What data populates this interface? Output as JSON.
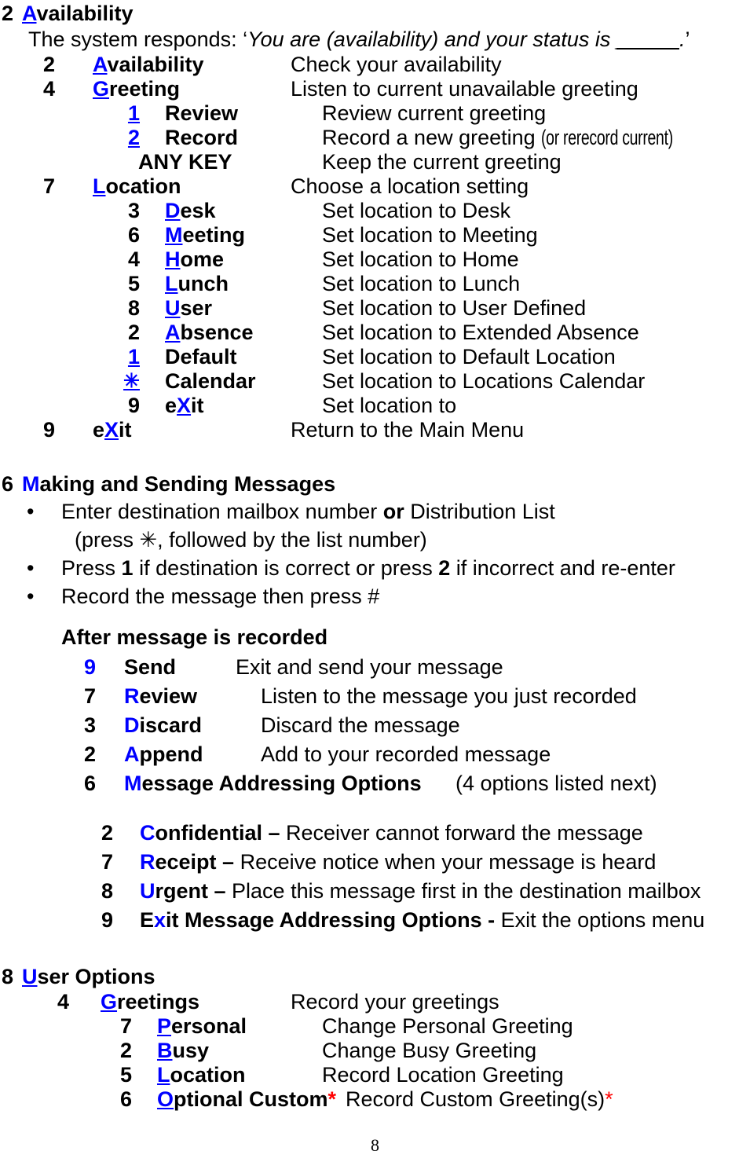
{
  "page": {
    "number": "8"
  },
  "sections": [
    {
      "id": "availability",
      "key": "2",
      "accent_letter": "A",
      "title_rest": "vailability",
      "prompt_prefix": "The system responds: ",
      "prompt_open_quote": "‘",
      "prompt_italic": "You are (availability) and your status is ",
      "prompt_blank": "_____",
      "prompt_tail": ".",
      "prompt_close_quote": "’",
      "entries": [
        {
          "key": "2",
          "accent": "A",
          "rest": "vailability",
          "desc": "Check your availability"
        },
        {
          "key": "4",
          "accent": "G",
          "rest": "reeting",
          "desc": "Listen to current unavailable greeting"
        }
      ],
      "greeting_sub": [
        {
          "key": "1",
          "key_blue": true,
          "name": "Review",
          "desc": "Review current greeting"
        },
        {
          "key": "2",
          "key_blue": true,
          "name": "Record",
          "desc": "Record a new greeting ",
          "desc_condensed": "(or rerecord current)"
        },
        {
          "key": "ANY KEY",
          "key_blue": false,
          "name": "",
          "desc": "Keep the current greeting"
        }
      ],
      "location": {
        "key": "7",
        "accent": "L",
        "rest": "ocation",
        "desc": "Choose a location setting"
      },
      "location_sub": [
        {
          "key": "3",
          "key_blue": false,
          "accent": "D",
          "rest": "esk",
          "desc": "Set location to Desk"
        },
        {
          "key": "6",
          "key_blue": false,
          "accent": "M",
          "rest": "eeting",
          "desc": "Set location to Meeting"
        },
        {
          "key": "4",
          "key_blue": false,
          "accent": "H",
          "rest": "ome",
          "desc": "Set location to Home"
        },
        {
          "key": "5",
          "key_blue": false,
          "accent": "L",
          "rest": "unch",
          "desc": "Set location to Lunch"
        },
        {
          "key": "8",
          "key_blue": false,
          "accent": "U",
          "rest": "ser",
          "desc": "Set location to User Defined"
        },
        {
          "key": "2",
          "key_blue": false,
          "accent": "A",
          "rest": "bsence",
          "desc": "Set location to Extended Absence"
        },
        {
          "key": "1",
          "key_blue": true,
          "accent": "",
          "rest": "Default",
          "desc": "Set location to Default Location"
        },
        {
          "key": "✳",
          "key_blue": true,
          "accent": "",
          "rest": "Calendar",
          "desc": "Set location to Locations Calendar"
        },
        {
          "key": "9",
          "key_blue": false,
          "accent": "",
          "pre": "e",
          "accent_mid": "X",
          "rest": "it",
          "desc": "Set location to"
        }
      ],
      "exit": {
        "key": "9",
        "pre": "e",
        "accent": "X",
        "rest": "it",
        "desc": "Return to the Main Menu"
      }
    },
    {
      "id": "making-sending",
      "key": "6",
      "accent_letter": "M",
      "accent_underline": false,
      "title_rest": "aking and Sending Messages",
      "bullets": [
        {
          "pre": "Enter destination mailbox number ",
          "bold": "or",
          "post": " Distribution List",
          "continuation": "(press ✳, followed by the list number)"
        },
        {
          "pre": "Press ",
          "bold": "1",
          "post": " if destination is correct or press ",
          "bold2": "2",
          "post2": " if incorrect and re-enter"
        },
        {
          "pre": "Record the message then press #"
        }
      ],
      "after_recorded_heading": "After message is recorded",
      "after_recorded": [
        {
          "key": "9",
          "key_blue": true,
          "accent": "",
          "name": "Send",
          "desc": "Exit and send your message"
        },
        {
          "key": "7",
          "key_blue": false,
          "accent": "R",
          "name": "eview",
          "desc": "Listen to the message you just recorded"
        },
        {
          "key": "3",
          "key_blue": false,
          "accent": "D",
          "name": "iscard",
          "desc": "Discard the message"
        },
        {
          "key": "2",
          "key_blue": false,
          "accent": "A",
          "name": "ppend",
          "desc": "Add to your recorded message"
        },
        {
          "key": "6",
          "key_blue": false,
          "accent": "M",
          "name": "essage Addressing Options",
          "desc": "(4 options listed next)"
        }
      ],
      "addressing_options": [
        {
          "key": "2",
          "accent": "C",
          "bold_rest": "onfidential –",
          "desc": " Receiver cannot forward the message"
        },
        {
          "key": "7",
          "accent": "R",
          "bold_rest": "eceipt –",
          "desc": " Receive notice when your message is heard"
        },
        {
          "key": "8",
          "accent": "U",
          "bold_rest": "rgent –",
          "desc": " Place this message first in the destination mailbox"
        },
        {
          "key": "9",
          "pre_black": "E",
          "accent": "x",
          "bold_rest": "it Message Addressing Options -",
          "desc": " Exit the options menu"
        }
      ]
    },
    {
      "id": "user-options",
      "key": "8",
      "accent_letter": "U",
      "title_rest": "ser Options",
      "greetings": {
        "key": "4",
        "accent": "G",
        "rest": "reetings",
        "desc": "Record your greetings"
      },
      "greetings_sub": [
        {
          "key": "7",
          "accent": "P",
          "rest": "ersonal",
          "desc": "Change Personal Greeting"
        },
        {
          "key": "2",
          "accent": "B",
          "rest": "usy",
          "desc": "Change Busy Greeting"
        },
        {
          "key": "5",
          "accent": "L",
          "rest": "ocation",
          "desc": "Record Location Greeting"
        },
        {
          "key": "6",
          "accent": "O",
          "rest": "ptional Custom",
          "star": "*",
          "desc": "Record Custom Greeting(s)",
          "desc_star": "*"
        }
      ]
    }
  ],
  "colors": {
    "accent_blue": "#0000FF",
    "star_red": "#FF0000",
    "text_black": "#000000"
  }
}
